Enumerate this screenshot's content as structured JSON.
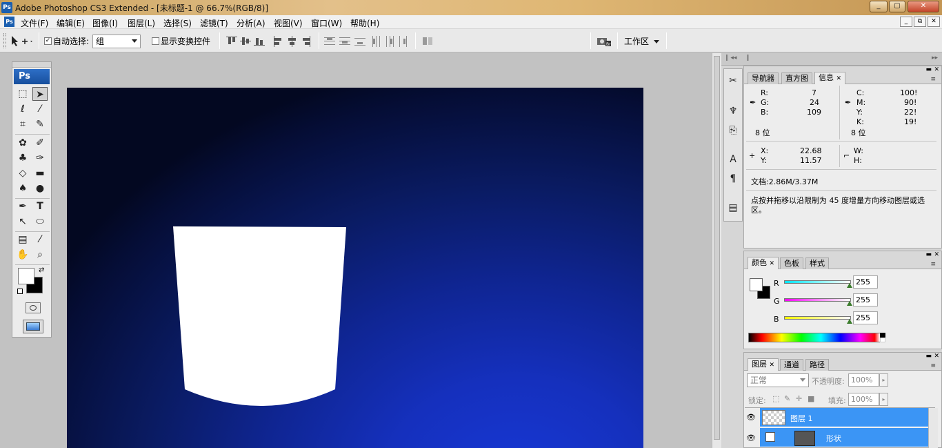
{
  "window": {
    "title": "Adobe Photoshop CS3 Extended - [未标题-1 @ 66.7%(RGB/8)]",
    "app_icon": "Ps",
    "buttons": [
      "_",
      "▢",
      "✕"
    ]
  },
  "menu": {
    "items": [
      "文件(F)",
      "编辑(E)",
      "图像(I)",
      "图层(L)",
      "选择(S)",
      "滤镜(T)",
      "分析(A)",
      "视图(V)",
      "窗口(W)",
      "帮助(H)"
    ],
    "doc_buttons": [
      "_",
      "⧉",
      "✕"
    ]
  },
  "options": {
    "auto_select_label": "自动选择:",
    "auto_select_checked": true,
    "group_value": "组",
    "show_transform_label": "显示变换控件",
    "show_transform_checked": false,
    "workspace_label": "工作区"
  },
  "toolbox": {
    "logo": "Ps"
  },
  "info_panel": {
    "tabs": [
      "导航器",
      "直方图",
      "信息"
    ],
    "active_tab": "信息",
    "rgb": [
      {
        "label": "R:",
        "value": "7"
      },
      {
        "label": "G:",
        "value": "24"
      },
      {
        "label": "B:",
        "value": "109"
      }
    ],
    "cmyk": [
      {
        "label": "C:",
        "value": "100!"
      },
      {
        "label": "M:",
        "value": "90!"
      },
      {
        "label": "Y:",
        "value": "22!"
      },
      {
        "label": "K:",
        "value": "19!"
      }
    ],
    "bits_left": "8 位",
    "bits_right": "8 位",
    "x_label": "X:",
    "x_value": "22.68",
    "y_label": "Y:",
    "y_value": "11.57",
    "w_label": "W:",
    "h_label": "H:",
    "doc_size": "文档:2.86M/3.37M",
    "hint": "点按并拖移以沿限制为 45 度增量方向移动图层或选区。"
  },
  "color_panel": {
    "tabs": [
      "颜色",
      "色板",
      "样式"
    ],
    "active_tab": "颜色",
    "channels": [
      {
        "label": "R",
        "value": "255",
        "color": "#00e5ff"
      },
      {
        "label": "G",
        "value": "255",
        "color": "#ff00ff"
      },
      {
        "label": "B",
        "value": "255",
        "color": "#ffff00"
      }
    ]
  },
  "layers_panel": {
    "tabs": [
      "图层",
      "通道",
      "路径"
    ],
    "active_tab": "图层",
    "blend_mode": "正常",
    "opacity_label": "不透明度:",
    "opacity_value": "100%",
    "lock_label": "锁定:",
    "fill_label": "填充:",
    "fill_value": "100%",
    "layers": [
      {
        "name": "图层 1",
        "selected": true
      },
      {
        "name": "形状",
        "selected": true
      }
    ]
  },
  "colors": {
    "accent_blue": "#3b95f5",
    "canvas_blue": "#1530bd",
    "shape_fill": "#ffffff"
  }
}
